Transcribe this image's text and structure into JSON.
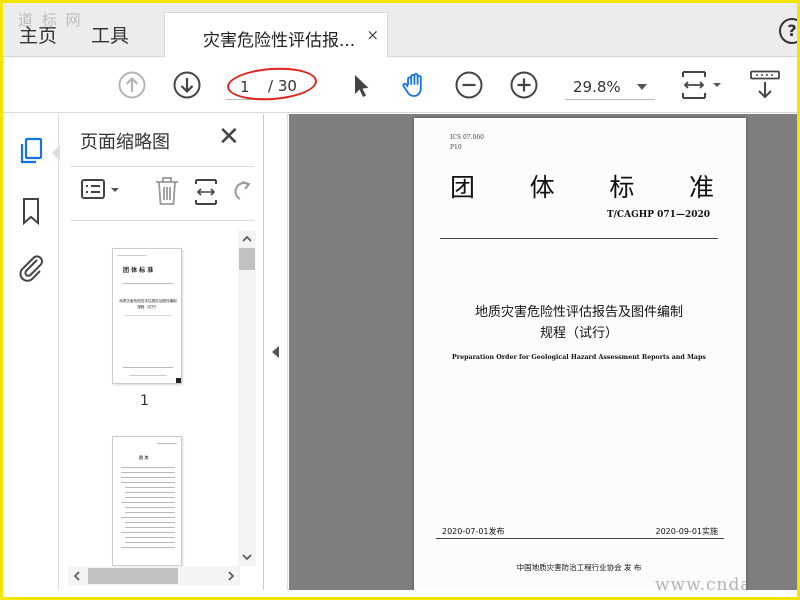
{
  "tabs": {
    "home": "主页",
    "tools": "工具",
    "document_title": "灾害危险性评估报...",
    "close_glyph": "×"
  },
  "help_glyph": "?",
  "watermarks": {
    "top": "道 标 网",
    "bottom": "www.cndao..."
  },
  "toolbar": {
    "page_current": "1",
    "page_total": "/ 30",
    "zoom": "29.8%"
  },
  "icons": {
    "prev_page": "arrow-up-circle-icon",
    "next_page": "arrow-down-circle-icon",
    "select": "cursor-arrow-icon",
    "hand": "hand-icon",
    "zoom_out": "minus-circle-icon",
    "zoom_in": "plus-circle-icon",
    "fit": "page-fit-icon",
    "scroll_mode": "scroll-mode-icon"
  },
  "panel": {
    "title": "页面缩略图",
    "close_glyph": "✕",
    "thumbnails": [
      {
        "number": "1"
      }
    ]
  },
  "thumbnail_page1": {
    "heading": "团   体   标   准",
    "title": "地质灾害危险性评估报告及图件编制",
    "subtitle": "规程（试行）"
  },
  "thumbnail_page2": {
    "heading": "目   次"
  },
  "document": {
    "ics": "ICS 07.060",
    "pcode": "P10",
    "heading_chars": [
      "团",
      "体",
      "标",
      "准"
    ],
    "standard_number": "T/CAGHP 071—2020",
    "title_line1": "地质灾害危险性评估报告及图件编制",
    "title_line2": "规程（试行）",
    "title_en": "Preparation Order for Geological Hazard Assessment Reports and Maps",
    "issue_date": "2020-07-01发布",
    "implement_date": "2020-09-01实施",
    "publisher": "中国地质灾害防治工程行业协会    发 布"
  },
  "colors": {
    "frame": "#f2e600",
    "annotation_ellipse": "#e0231c",
    "accent_blue": "#1473e6",
    "doc_background": "#7f7f7f"
  }
}
